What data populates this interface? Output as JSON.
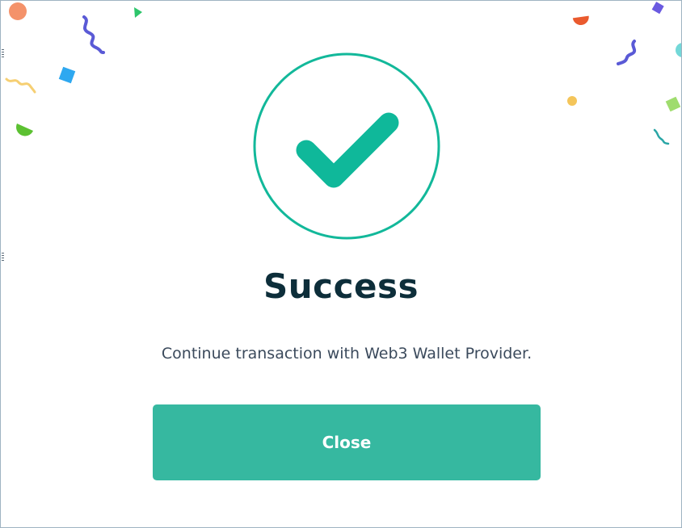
{
  "dialog": {
    "title": "Success",
    "message": "Continue transaction with Web3 Wallet Provider.",
    "close_label": "Close",
    "icon": "check-circle-icon"
  },
  "colors": {
    "accent": "#12b89a",
    "button": "#36b8a0",
    "title": "#0d2e3a",
    "text": "#3b4a5c"
  }
}
